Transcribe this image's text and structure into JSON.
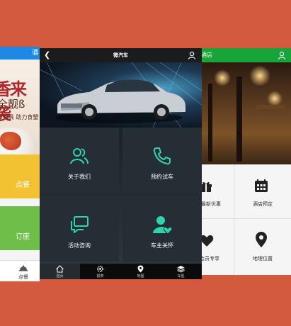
{
  "left_app": {
    "header_title": "酒",
    "banner": {
      "line1": "香来袭",
      "line2": "全靓ß",
      "line3": "U蟹具 助力食蟹"
    },
    "tiles": [
      {
        "label": "点餐",
        "color": "#f2c233"
      },
      {
        "label": "订座",
        "color": "#6dbf4a"
      }
    ],
    "tabbar": {
      "label": "点餐"
    }
  },
  "center_app": {
    "nav": {
      "title": "微汽车",
      "back_icon": "chevron-left-icon",
      "user_icon": "user-icon"
    },
    "menu": [
      {
        "label": "关于我们",
        "icon": "people-icon"
      },
      {
        "label": "预约试车",
        "icon": "phone-icon"
      },
      {
        "label": "活动咨询",
        "icon": "chat-icon"
      },
      {
        "label": "车主关怀",
        "icon": "user-heart-icon"
      }
    ],
    "tabs": [
      {
        "label": "首页",
        "icon": "home-icon",
        "active": true
      },
      {
        "label": "报表",
        "icon": "gear-icon",
        "active": false
      },
      {
        "label": "地图",
        "icon": "pin-icon",
        "active": false
      },
      {
        "label": "车型",
        "icon": "layers-icon",
        "active": false
      }
    ],
    "accent": "#2fd3b0"
  },
  "right_app": {
    "header_title": "酒店",
    "header_color": "#17a53a",
    "grid": [
      {
        "label": "最新优惠",
        "icon": "gift-icon"
      },
      {
        "label": "酒店预定",
        "icon": "calendar-icon"
      },
      {
        "label": "会员专享",
        "icon": "heart-icon"
      },
      {
        "label": "地理位置",
        "icon": "map-pin-icon"
      }
    ]
  }
}
